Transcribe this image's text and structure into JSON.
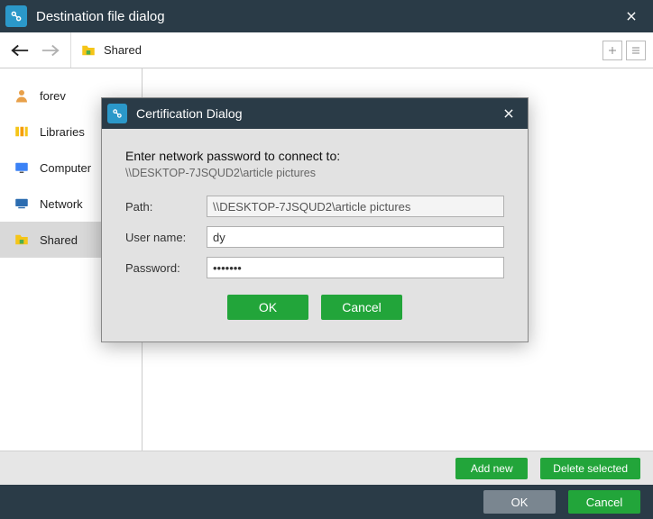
{
  "window": {
    "title": "Destination file dialog"
  },
  "breadcrumb": {
    "label": "Shared"
  },
  "sidebar": {
    "items": [
      {
        "label": "forev"
      },
      {
        "label": "Libraries"
      },
      {
        "label": "Computer"
      },
      {
        "label": "Network"
      },
      {
        "label": "Shared"
      }
    ]
  },
  "actions": {
    "add_new": "Add new",
    "delete_selected": "Delete selected",
    "ok": "OK",
    "cancel": "Cancel"
  },
  "modal": {
    "title": "Certification Dialog",
    "prompt": "Enter network password to connect to:",
    "target_path": "\\\\DESKTOP-7JSQUD2\\article pictures",
    "labels": {
      "path": "Path:",
      "user": "User name:",
      "password": "Password:"
    },
    "fields": {
      "path": "\\\\DESKTOP-7JSQUD2\\article pictures",
      "user": "dy",
      "password": "•••••••"
    },
    "buttons": {
      "ok": "OK",
      "cancel": "Cancel"
    }
  }
}
